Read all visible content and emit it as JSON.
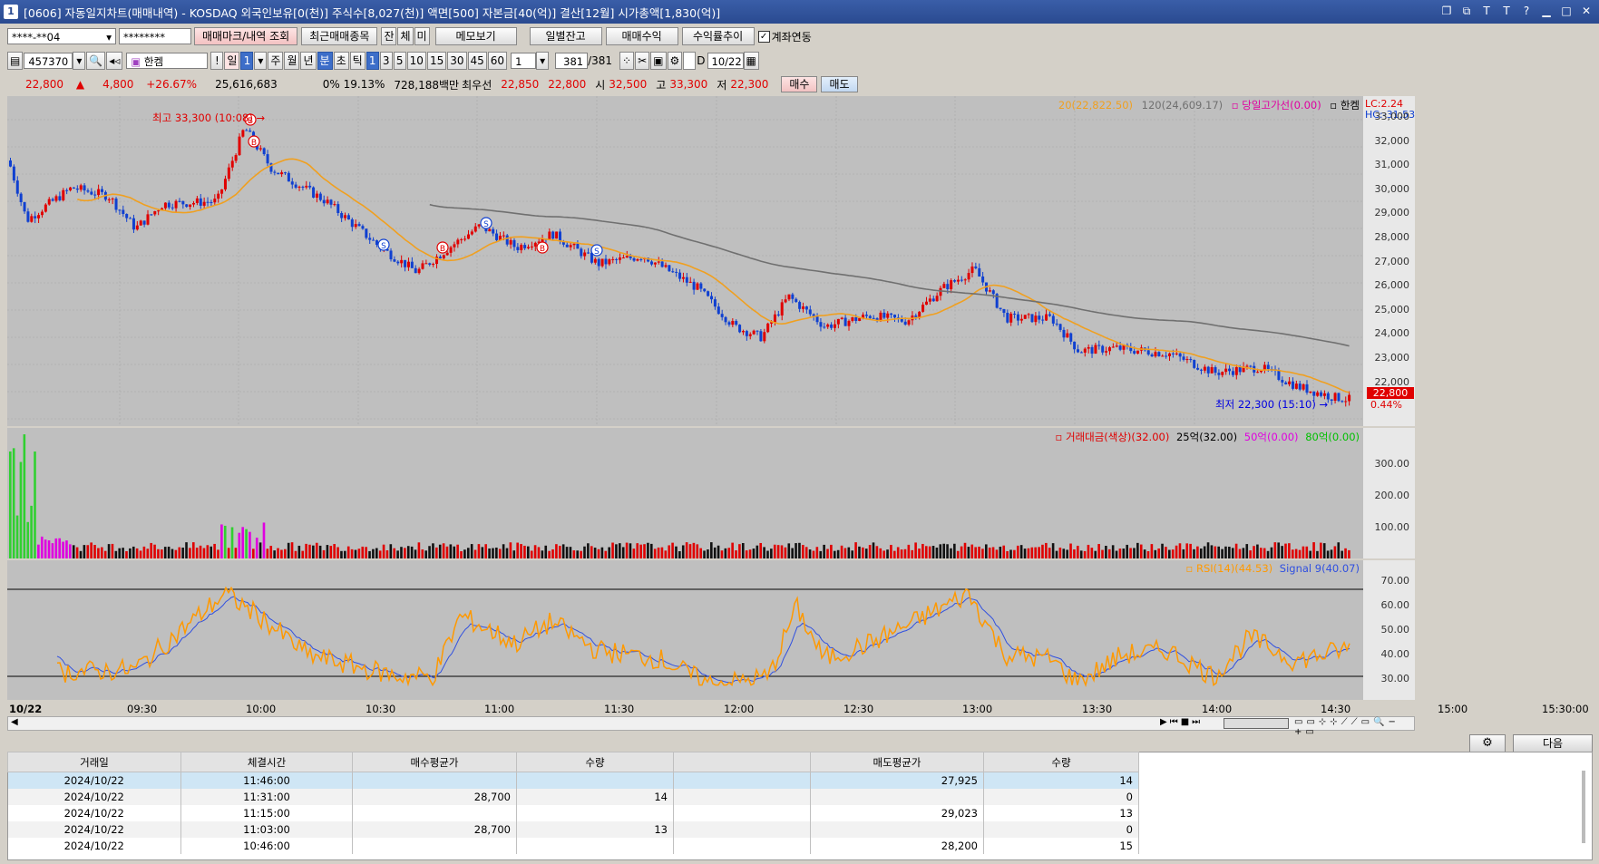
{
  "window": {
    "title": "[0606] 자동일지차트(매매내역) - KOSDAQ 외국인보유[0(천)] 주식수[8,027(천)] 액면[500] 자본금[40(억)] 결산[12월] 시가총액[1,830(억)]",
    "number": "1"
  },
  "toolbar1": {
    "account": "****-**04",
    "password": "********",
    "btn_trade_mark": "매매마크/내역 조회",
    "btn_recent": "최근매매종목",
    "btn_jan": "잔",
    "btn_che": "체",
    "btn_mi": "미",
    "btn_memo": "메모보기",
    "btn_daily_balance": "일별잔고",
    "btn_trade_profit": "매매수익",
    "btn_profit_trend": "수익률추이",
    "account_link_label": "계좌연동"
  },
  "toolbar2": {
    "code": "457370",
    "name": "한켐",
    "excl": "!",
    "day_label": "일",
    "day_num": "1",
    "periods": [
      "주",
      "월",
      "년",
      "분",
      "초",
      "틱"
    ],
    "minutes": [
      "1",
      "3",
      "5",
      "10",
      "15",
      "30",
      "45",
      "60"
    ],
    "count": "1",
    "range": "381",
    "range_total": "/381",
    "date": "10/22",
    "d_label": "D"
  },
  "quote": {
    "price": "22,800",
    "arrow": "▲",
    "change": "4,800",
    "pct": "+26.67%",
    "volume": "25,616,683",
    "ratio": "0% 19.13%",
    "amount": "728,188백만",
    "best_label": "최우선",
    "ask": "22,850",
    "bid": "22,800",
    "open_label": "시",
    "open": "32,500",
    "high_label": "고",
    "high": "33,300",
    "low_label": "저",
    "low": "22,300",
    "buy": "매수",
    "sell": "매도"
  },
  "price_panel": {
    "legend_ma20": "20(22,822.50)",
    "legend_ma120": "120(24,609.17)",
    "legend_prev_high": "당일고가선(0.00)",
    "legend_name": "한켐",
    "lc": "LC:2.24",
    "hc": "HC:-31.53",
    "high_marker": "최고 33,300 (10:08)",
    "low_marker": "최저 22,300 (15:10)",
    "last_price": "22,800",
    "last_pct": "0.44%",
    "yticks": [
      "33,000",
      "32,000",
      "31,000",
      "30,000",
      "29,000",
      "28,000",
      "27,000",
      "26,000",
      "25,000",
      "24,000",
      "23,000",
      "22,000"
    ]
  },
  "volume_panel": {
    "legend_amount": "거래대금(색상)(32.00)",
    "legend_25": "25억(32.00)",
    "legend_50": "50억(0.00)",
    "legend_80": "80억(0.00)",
    "yticks": [
      "300.00",
      "200.00",
      "100.00"
    ]
  },
  "rsi_panel": {
    "legend_rsi": "RSI(14)(44.53)",
    "legend_signal": "Signal 9(40.07)",
    "yticks": [
      "70.00",
      "60.00",
      "50.00",
      "40.00",
      "30.00"
    ]
  },
  "time_axis": {
    "date": "10/22",
    "labels": [
      "09:30",
      "10:00",
      "10:30",
      "11:00",
      "11:30",
      "12:00",
      "12:30",
      "13:00",
      "13:30",
      "14:00",
      "14:30",
      "15:00",
      "15:30:00"
    ]
  },
  "bottom": {
    "next_label": "다음"
  },
  "trade_table": {
    "headers": [
      "거래일",
      "체결시간",
      "매수평균가",
      "수량",
      "",
      "매도평균가",
      "수량"
    ],
    "rows": [
      [
        "2024/10/22",
        "11:46:00",
        "",
        "",
        "",
        "27,925",
        "14"
      ],
      [
        "2024/10/22",
        "11:31:00",
        "28,700",
        "14",
        "",
        "",
        "0"
      ],
      [
        "2024/10/22",
        "11:15:00",
        "",
        "",
        "",
        "29,023",
        "13"
      ],
      [
        "2024/10/22",
        "11:03:00",
        "28,700",
        "13",
        "",
        "",
        "0"
      ],
      [
        "2024/10/22",
        "10:46:00",
        "",
        "",
        "",
        "28,200",
        "15"
      ]
    ]
  },
  "colors": {
    "up": "#e00000",
    "down": "#1040d0",
    "ma20": "#f0a020",
    "ma120": "#707070",
    "rsi": "#ff9900",
    "signal": "#3050e0"
  }
}
